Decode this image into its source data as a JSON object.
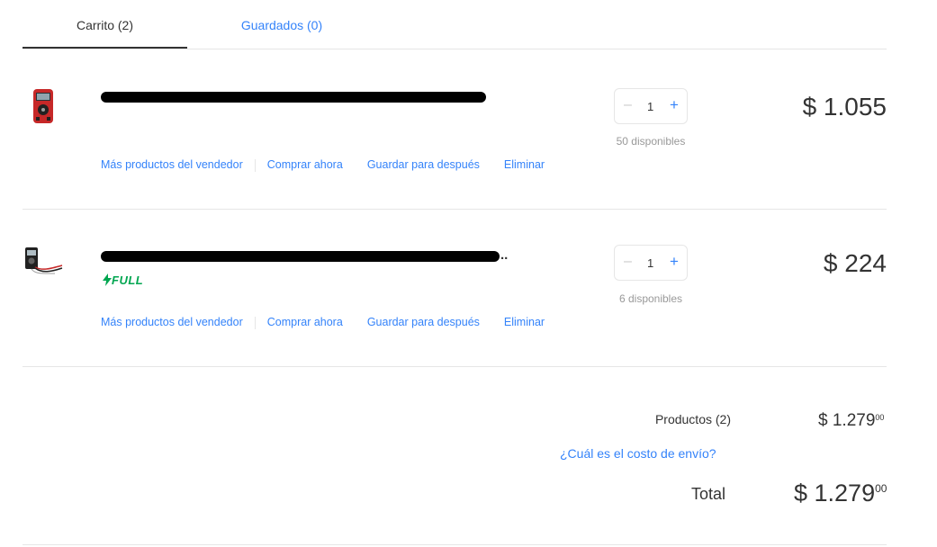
{
  "tabs": {
    "cart": "Carrito (2)",
    "saved": "Guardados (0)"
  },
  "items": [
    {
      "thumb_icon": "red-multimeter-icon",
      "title_suffix": "",
      "badge": "",
      "quantity": "1",
      "available": "50 disponibles",
      "price": "$ 1.055",
      "actions": [
        "Más productos del vendedor",
        "Comprar ahora",
        "Guardar para después",
        "Eliminar"
      ]
    },
    {
      "thumb_icon": "black-multimeter-icon",
      "title_suffix": "..",
      "badge": "FULL",
      "quantity": "1",
      "available": "6 disponibles",
      "price": "$ 224",
      "actions": [
        "Más productos del vendedor",
        "Comprar ahora",
        "Guardar para después",
        "Eliminar"
      ]
    }
  ],
  "summary": {
    "products_label": "Productos (2)",
    "products_value": "$ 1.279",
    "products_cents": "00",
    "shipping_link": "¿Cuál es el costo de envío?",
    "total_label": "Total",
    "total_value": "$ 1.279",
    "total_cents": "00"
  },
  "colors": {
    "accent": "#3483fa",
    "full_green": "#00a650",
    "divider": "#e6e6e6"
  }
}
